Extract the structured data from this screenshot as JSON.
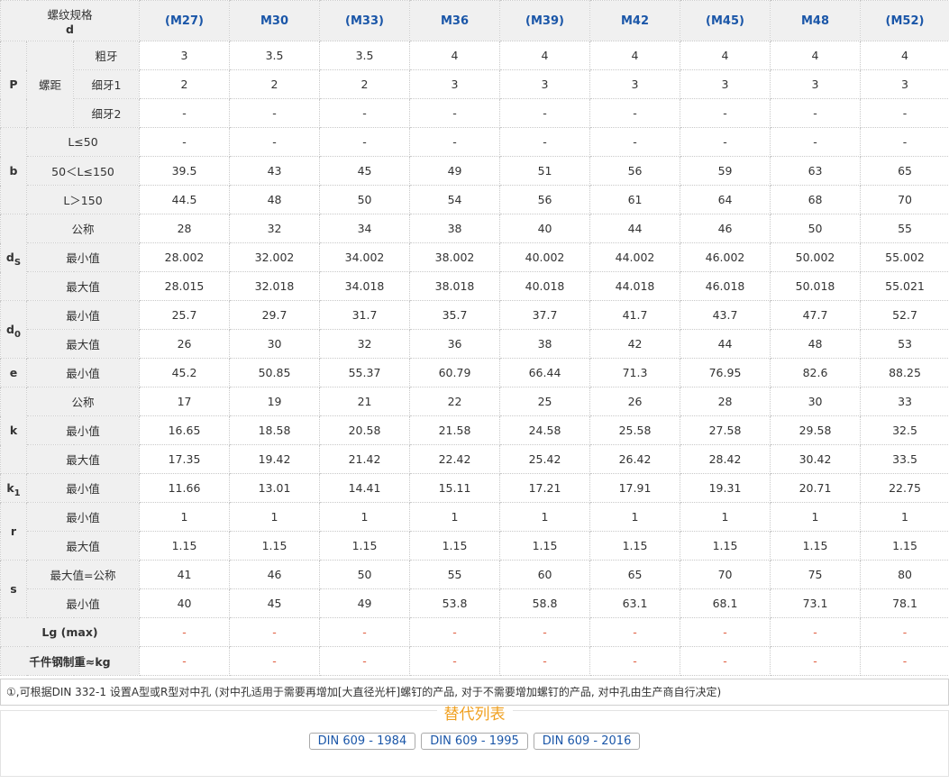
{
  "header": {
    "spec_label": "螺纹规格",
    "spec_symbol": "d"
  },
  "sizes": [
    "(M27)",
    "M30",
    "(M33)",
    "M36",
    "(M39)",
    "M42",
    "(M45)",
    "M48",
    "(M52)"
  ],
  "groups": [
    {
      "symbol": "P",
      "sub": "",
      "mid": "螺距",
      "rows": [
        {
          "label": "粗牙",
          "values": [
            "3",
            "3.5",
            "3.5",
            "4",
            "4",
            "4",
            "4",
            "4",
            "4"
          ]
        },
        {
          "label": "细牙1",
          "values": [
            "2",
            "2",
            "2",
            "3",
            "3",
            "3",
            "3",
            "3",
            "3"
          ]
        },
        {
          "label": "细牙2",
          "values": [
            "-",
            "-",
            "-",
            "-",
            "-",
            "-",
            "-",
            "-",
            "-"
          ]
        }
      ]
    },
    {
      "symbol": "b",
      "sub": "",
      "rows": [
        {
          "label": "L≤50",
          "values": [
            "-",
            "-",
            "-",
            "-",
            "-",
            "-",
            "-",
            "-",
            "-"
          ]
        },
        {
          "label": "50＜L≤150",
          "values": [
            "39.5",
            "43",
            "45",
            "49",
            "51",
            "56",
            "59",
            "63",
            "65"
          ]
        },
        {
          "label": "L＞150",
          "values": [
            "44.5",
            "48",
            "50",
            "54",
            "56",
            "61",
            "64",
            "68",
            "70"
          ]
        }
      ]
    },
    {
      "symbol": "d",
      "sub": "S",
      "rows": [
        {
          "label": "公称",
          "values": [
            "28",
            "32",
            "34",
            "38",
            "40",
            "44",
            "46",
            "50",
            "55"
          ]
        },
        {
          "label": "最小值",
          "values": [
            "28.002",
            "32.002",
            "34.002",
            "38.002",
            "40.002",
            "44.002",
            "46.002",
            "50.002",
            "55.002"
          ]
        },
        {
          "label": "最大值",
          "values": [
            "28.015",
            "32.018",
            "34.018",
            "38.018",
            "40.018",
            "44.018",
            "46.018",
            "50.018",
            "55.021"
          ]
        }
      ]
    },
    {
      "symbol": "d",
      "sub": "0",
      "rows": [
        {
          "label": "最小值",
          "values": [
            "25.7",
            "29.7",
            "31.7",
            "35.7",
            "37.7",
            "41.7",
            "43.7",
            "47.7",
            "52.7"
          ]
        },
        {
          "label": "最大值",
          "values": [
            "26",
            "30",
            "32",
            "36",
            "38",
            "42",
            "44",
            "48",
            "53"
          ]
        }
      ]
    },
    {
      "symbol": "e",
      "sub": "",
      "rows": [
        {
          "label": "最小值",
          "values": [
            "45.2",
            "50.85",
            "55.37",
            "60.79",
            "66.44",
            "71.3",
            "76.95",
            "82.6",
            "88.25"
          ]
        }
      ]
    },
    {
      "symbol": "k",
      "sub": "",
      "rows": [
        {
          "label": "公称",
          "values": [
            "17",
            "19",
            "21",
            "22",
            "25",
            "26",
            "28",
            "30",
            "33"
          ]
        },
        {
          "label": "最小值",
          "values": [
            "16.65",
            "18.58",
            "20.58",
            "21.58",
            "24.58",
            "25.58",
            "27.58",
            "29.58",
            "32.5"
          ]
        },
        {
          "label": "最大值",
          "values": [
            "17.35",
            "19.42",
            "21.42",
            "22.42",
            "25.42",
            "26.42",
            "28.42",
            "30.42",
            "33.5"
          ]
        }
      ]
    },
    {
      "symbol": "k",
      "sub": "1",
      "rows": [
        {
          "label": "最小值",
          "values": [
            "11.66",
            "13.01",
            "14.41",
            "15.11",
            "17.21",
            "17.91",
            "19.31",
            "20.71",
            "22.75"
          ]
        }
      ]
    },
    {
      "symbol": "r",
      "sub": "",
      "rows": [
        {
          "label": "最小值",
          "values": [
            "1",
            "1",
            "1",
            "1",
            "1",
            "1",
            "1",
            "1",
            "1"
          ]
        },
        {
          "label": "最大值",
          "values": [
            "1.15",
            "1.15",
            "1.15",
            "1.15",
            "1.15",
            "1.15",
            "1.15",
            "1.15",
            "1.15"
          ]
        }
      ]
    },
    {
      "symbol": "s",
      "sub": "",
      "rows": [
        {
          "label": "最大值=公称",
          "values": [
            "41",
            "46",
            "50",
            "55",
            "60",
            "65",
            "70",
            "75",
            "80"
          ]
        },
        {
          "label": "最小值",
          "values": [
            "40",
            "45",
            "49",
            "53.8",
            "58.8",
            "63.1",
            "68.1",
            "73.1",
            "78.1"
          ]
        }
      ]
    }
  ],
  "footer_rows": [
    {
      "label": "Lg (max)",
      "values": [
        "-",
        "-",
        "-",
        "-",
        "-",
        "-",
        "-",
        "-",
        "-"
      ]
    },
    {
      "label": "千件钢制重≈kg",
      "values": [
        "-",
        "-",
        "-",
        "-",
        "-",
        "-",
        "-",
        "-",
        "-"
      ]
    }
  ],
  "note": "①,可根据DIN 332-1 设置A型或R型对中孔 (对中孔适用于需要再增加[大直径光杆]螺钉的产品, 对于不需要增加螺钉的产品, 对中孔由生产商自行决定)",
  "alternatives": {
    "title": "替代列表",
    "items": [
      "DIN 609 - 1984",
      "DIN 609 - 1995",
      "DIN 609 - 2016"
    ]
  }
}
